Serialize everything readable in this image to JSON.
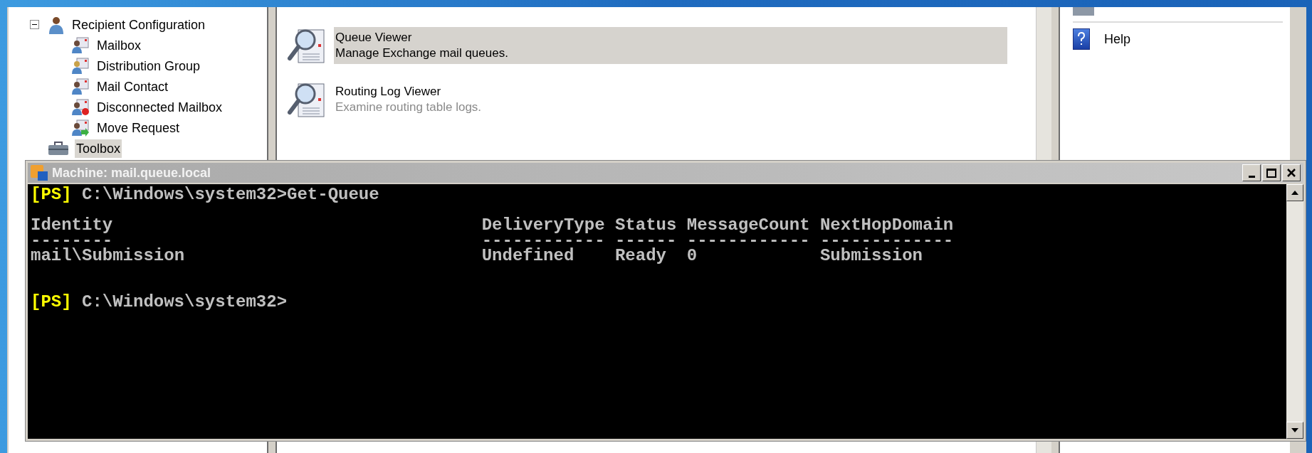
{
  "tree": {
    "items": [
      {
        "label": "Recipient Configuration",
        "selected": false,
        "expanded": true,
        "children": [
          {
            "label": "Mailbox",
            "selected": false
          },
          {
            "label": "Distribution Group",
            "selected": false
          },
          {
            "label": "Mail Contact",
            "selected": false
          },
          {
            "label": "Disconnected Mailbox",
            "selected": false
          },
          {
            "label": "Move Request",
            "selected": false
          }
        ]
      },
      {
        "label": "Toolbox",
        "selected": true
      }
    ]
  },
  "tools": [
    {
      "title": "Queue Viewer",
      "description": "Manage Exchange mail queues.",
      "selected": true
    },
    {
      "title": "Routing Log Viewer",
      "description": "Examine routing table logs.",
      "selected": false
    }
  ],
  "actions": [
    {
      "label": "Help"
    }
  ],
  "console": {
    "title": "Machine: mail.queue.local",
    "command_prompt": {
      "tag": "[PS]",
      "text": "C:\\Windows\\system32>Get-Queue"
    },
    "table": {
      "columns": [
        {
          "header": "Identity",
          "rule": "--------"
        },
        {
          "header": "DeliveryType",
          "rule": "------------"
        },
        {
          "header": "Status",
          "rule": "------"
        },
        {
          "header": "MessageCount",
          "rule": "------------"
        },
        {
          "header": "NextHopDomain",
          "rule": "-------------"
        }
      ],
      "rows": [
        [
          "mail\\Submission",
          "Undefined",
          "Ready",
          "0",
          "Submission"
        ]
      ]
    },
    "current_prompt": {
      "tag": "[PS]",
      "text": "C:\\Windows\\system32>"
    }
  }
}
